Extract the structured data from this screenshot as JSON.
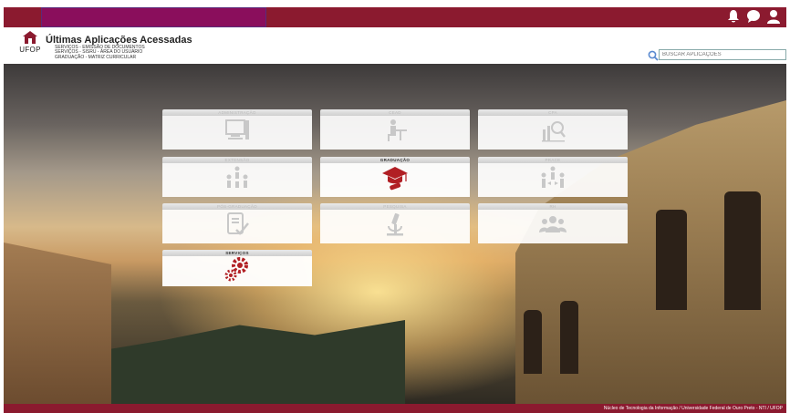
{
  "header": {
    "title": "Últimas Aplicações Acessadas",
    "logo_label": "UFOP",
    "recent": [
      "SERVIÇOS - EMISSÃO DE DOCUMENTOS",
      "SERVIÇOS - SISRU - ÁREA DO USUÁRIO",
      "GRADUAÇÃO - MATRIZ CURRICULAR"
    ]
  },
  "search": {
    "placeholder": "BUSCAR APLICAÇÕES"
  },
  "topbar": {
    "icons": [
      "bell-icon",
      "chat-icon",
      "user-icon"
    ]
  },
  "tiles": [
    {
      "key": "administracao",
      "label": "ADMINISTRAÇÃO",
      "icon": "computer-icon",
      "state": "dim"
    },
    {
      "key": "cead",
      "label": "CEAD",
      "icon": "student-desk-icon",
      "state": "dim"
    },
    {
      "key": "cpa",
      "label": "CPA",
      "icon": "chart-search-icon",
      "state": "dim"
    },
    {
      "key": "extensao",
      "label": "EXTENSÃO",
      "icon": "people-network-icon",
      "state": "dim"
    },
    {
      "key": "graduacao",
      "label": "GRADUAÇÃO",
      "icon": "graduation-cap-icon",
      "state": "active"
    },
    {
      "key": "prace",
      "label": "PRACE",
      "icon": "group-exchange-icon",
      "state": "dim"
    },
    {
      "key": "pos-graduacao",
      "label": "PÓS-GRADUAÇÃO",
      "icon": "document-check-icon",
      "state": "dim"
    },
    {
      "key": "pesquisa",
      "label": "PESQUISA",
      "icon": "microscope-icon",
      "state": "dim"
    },
    {
      "key": "rh",
      "label": "RH",
      "icon": "users-icon",
      "state": "dim"
    },
    {
      "key": "servicos",
      "label": "SERVIÇOS",
      "icon": "gears-icon",
      "state": "active"
    }
  ],
  "footer": {
    "text": "Núcleo de Tecnologia da Informação / Universidade Federal de Ouro Preto - NTI / UFOP"
  },
  "colors": {
    "brand": "#8b1a2f",
    "accent": "#b11f24",
    "purple": "#8a0e5c",
    "icon_dim": "#c8c8c8"
  }
}
